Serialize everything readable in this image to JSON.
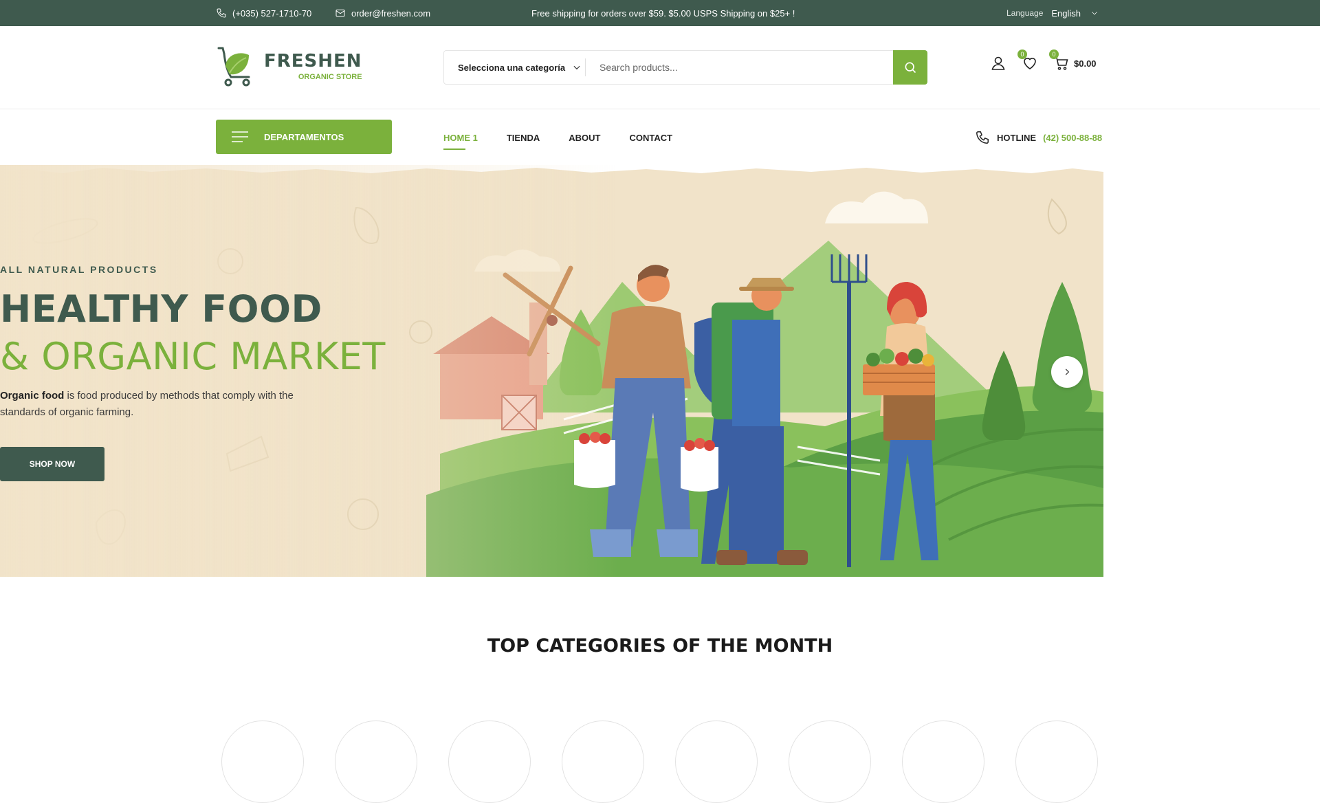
{
  "topbar": {
    "phone": "(+035) 527-1710-70",
    "email": "order@freshen.com",
    "promo": "Free shipping for orders over $59. $5.00 USPS Shipping on $25+ !",
    "language_label": "Language",
    "language_value": "English"
  },
  "header": {
    "brand": "FRESHEN",
    "tagline": "ORGANIC STORE",
    "search": {
      "category": "Selecciona una categoría",
      "placeholder": "Search products..."
    },
    "wishlist_count": "0",
    "cart_count": "0",
    "cart_total": "$0.00"
  },
  "nav": {
    "departments": "DEPARTAMENTOS",
    "items": [
      "HOME 1",
      "TIENDA",
      "ABOUT",
      "CONTACT"
    ],
    "hotline_label": "HOTLINE",
    "hotline_number": "(42) 500-88-88"
  },
  "hero": {
    "eyebrow": "ALL NATURAL PRODUCTS",
    "title_line1": "HEALTHY FOOD",
    "title_line2": "& ORGANIC MARKET",
    "desc_bold": "Organic food",
    "desc_rest": " is food produced by methods that comply with the standards of organic farming.",
    "cta": "SHOP NOW"
  },
  "categories": {
    "title": "TOP CATEGORIES OF THE MONTH"
  },
  "colors": {
    "dark_green": "#3f5a4e",
    "accent_green": "#7bb13c",
    "hero_bg": "#f1e3c9"
  }
}
